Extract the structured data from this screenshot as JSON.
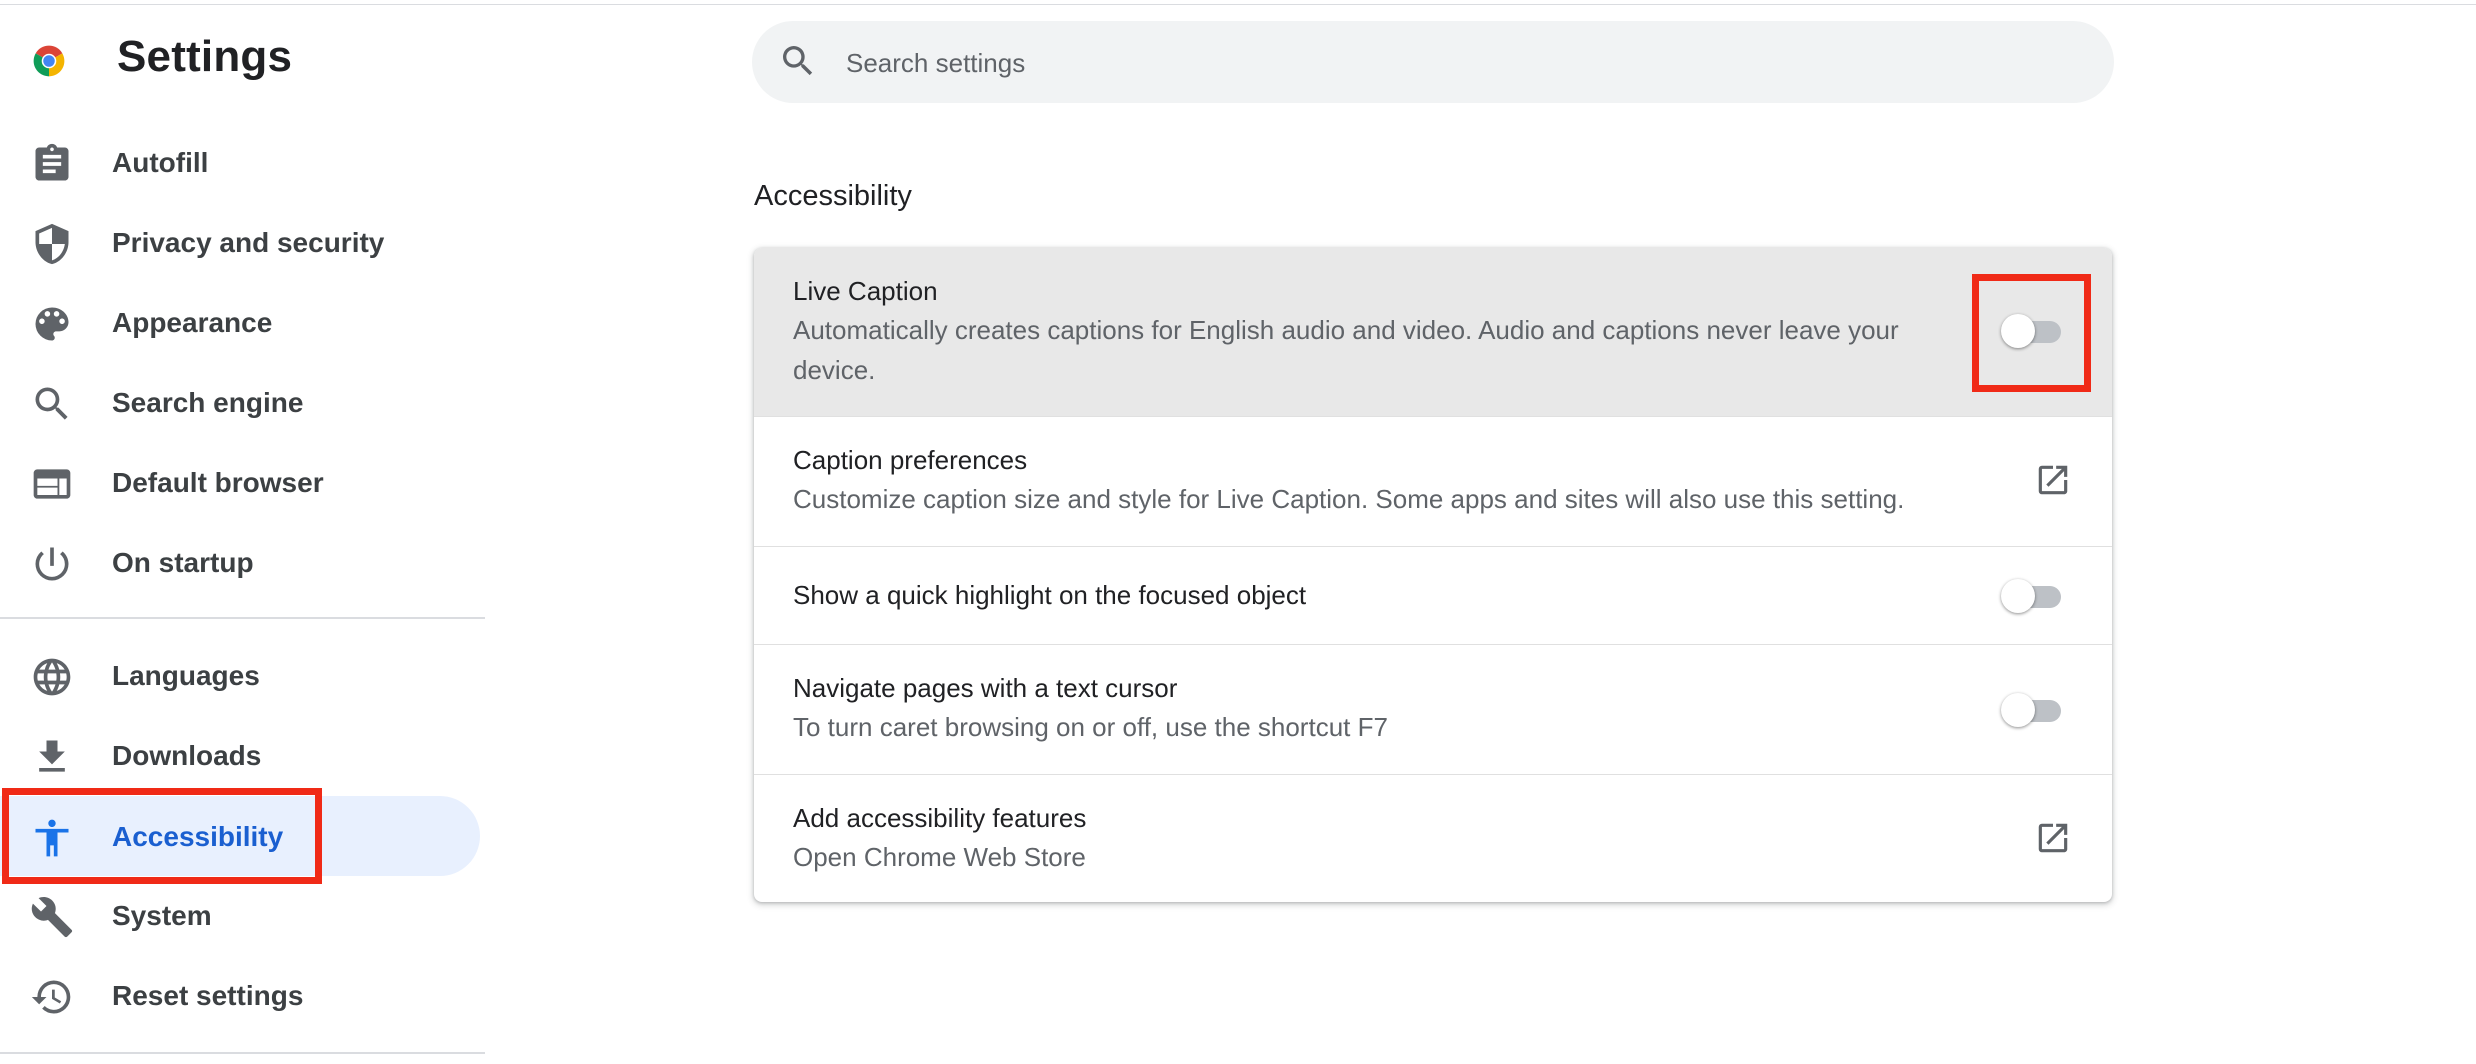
{
  "app": {
    "title": "Settings"
  },
  "sidebar": {
    "items": [
      {
        "label": "Autofill",
        "icon": "clipboard-icon"
      },
      {
        "label": "Privacy and security",
        "icon": "shield-icon"
      },
      {
        "label": "Appearance",
        "icon": "palette-icon"
      },
      {
        "label": "Search engine",
        "icon": "search-icon"
      },
      {
        "label": "Default browser",
        "icon": "browser-window-icon"
      },
      {
        "label": "On startup",
        "icon": "power-icon"
      },
      {
        "label": "Languages",
        "icon": "globe-icon"
      },
      {
        "label": "Downloads",
        "icon": "download-icon"
      },
      {
        "label": "Accessibility",
        "icon": "accessibility-icon",
        "active": true
      },
      {
        "label": "System",
        "icon": "wrench-icon"
      },
      {
        "label": "Reset settings",
        "icon": "history-icon"
      }
    ]
  },
  "search": {
    "placeholder": "Search settings",
    "value": ""
  },
  "section": {
    "title": "Accessibility"
  },
  "rows": [
    {
      "title": "Live Caption",
      "subtitle": "Automatically creates captions for English audio and video. Audio and captions never leave your device.",
      "control": "toggle",
      "enabled": false
    },
    {
      "title": "Caption preferences",
      "subtitle": "Customize caption size and style for Live Caption. Some apps and sites will also use this setting.",
      "control": "external-link-icon"
    },
    {
      "title": "Show a quick highlight on the focused object",
      "control": "toggle",
      "enabled": false
    },
    {
      "title": "Navigate pages with a text cursor",
      "subtitle": "To turn caret browsing on or off, use the shortcut F7",
      "control": "toggle",
      "enabled": false
    },
    {
      "title": "Add accessibility features",
      "subtitle": "Open Chrome Web Store",
      "control": "external-link-icon"
    }
  ],
  "colors": {
    "accent": "#1a73e8",
    "active_nav_bg": "#e8f0fe",
    "annotation_red": "#f02a17",
    "toggle_off_track": "#bdc1c6"
  }
}
